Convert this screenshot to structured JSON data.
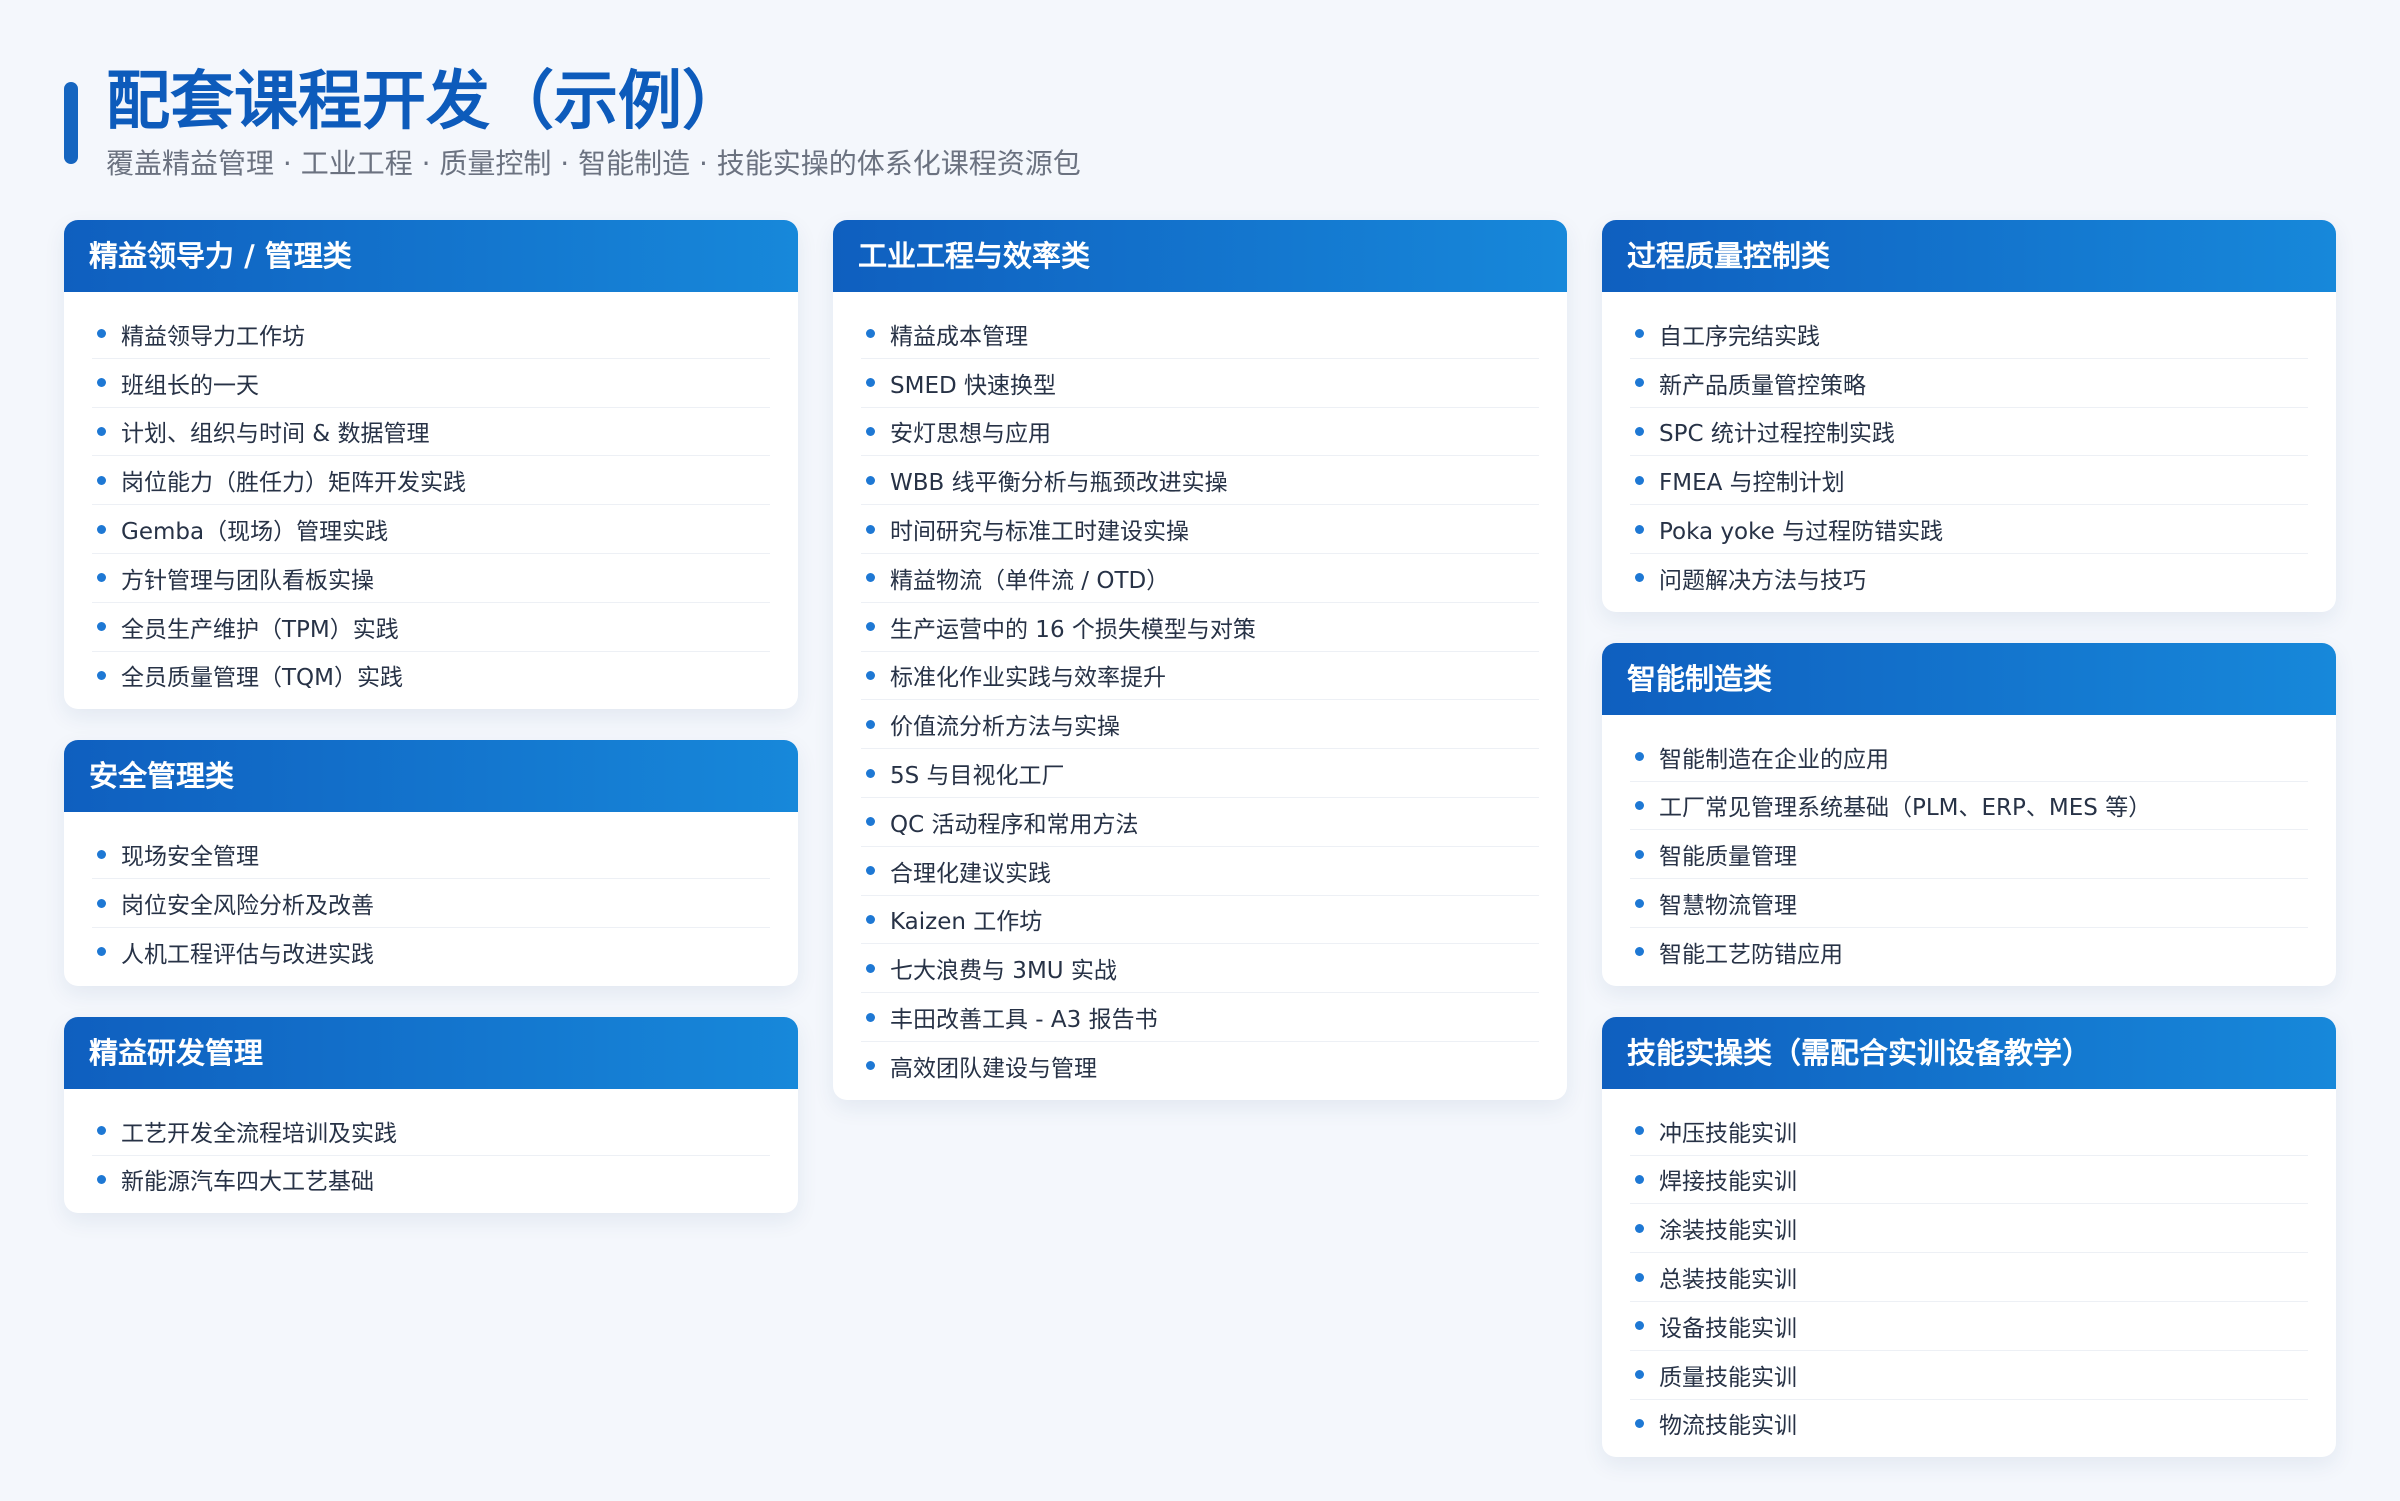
{
  "header": {
    "title": "配套课程开发（示例）",
    "subtitle": "覆盖精益管理 · 工业工程 · 质量控制 · 智能制造 · 技能实操的体系化课程资源包"
  },
  "colors": {
    "primary": "#0d5bbb",
    "header_start": "#0f5fbf",
    "header_end": "#1788da",
    "bullet": "#1e78d4",
    "background": "#f4f7fc"
  },
  "columns": [
    {
      "cards": [
        {
          "title": "精益领导力 / 管理类",
          "items": [
            "精益领导力工作坊",
            "班组长的一天",
            "计划、组织与时间 & 数据管理",
            "岗位能力（胜任力）矩阵开发实践",
            "Gemba（现场）管理实践",
            "方针管理与团队看板实操",
            "全员生产维护（TPM）实践",
            "全员质量管理（TQM）实践"
          ]
        },
        {
          "title": "安全管理类",
          "items": [
            "现场安全管理",
            "岗位安全风险分析及改善",
            "人机工程评估与改进实践"
          ]
        },
        {
          "title": "精益研发管理",
          "items": [
            "工艺开发全流程培训及实践",
            "新能源汽车四大工艺基础"
          ]
        }
      ]
    },
    {
      "cards": [
        {
          "title": "工业工程与效率类",
          "items": [
            "精益成本管理",
            "SMED 快速换型",
            "安灯思想与应用",
            "WBB 线平衡分析与瓶颈改进实操",
            "时间研究与标准工时建设实操",
            "精益物流（单件流 / OTD）",
            "生产运营中的 16 个损失模型与对策",
            "标准化作业实践与效率提升",
            "价值流分析方法与实操",
            "5S 与目视化工厂",
            "QC 活动程序和常用方法",
            "合理化建议实践",
            "Kaizen 工作坊",
            "七大浪费与 3MU 实战",
            "丰田改善工具 - A3 报告书",
            "高效团队建设与管理"
          ]
        }
      ]
    },
    {
      "cards": [
        {
          "title": "过程质量控制类",
          "items": [
            "自工序完结实践",
            "新产品质量管控策略",
            "SPC 统计过程控制实践",
            "FMEA 与控制计划",
            "Poka yoke 与过程防错实践",
            "问题解决方法与技巧"
          ]
        },
        {
          "title": "智能制造类",
          "items": [
            "智能制造在企业的应用",
            "工厂常见管理系统基础（PLM、ERP、MES 等）",
            "智能质量管理",
            "智慧物流管理",
            "智能工艺防错应用"
          ]
        },
        {
          "title": "技能实操类（需配合实训设备教学）",
          "items": [
            "冲压技能实训",
            "焊接技能实训",
            "涂装技能实训",
            "总装技能实训",
            "设备技能实训",
            "质量技能实训",
            "物流技能实训"
          ]
        }
      ]
    }
  ]
}
